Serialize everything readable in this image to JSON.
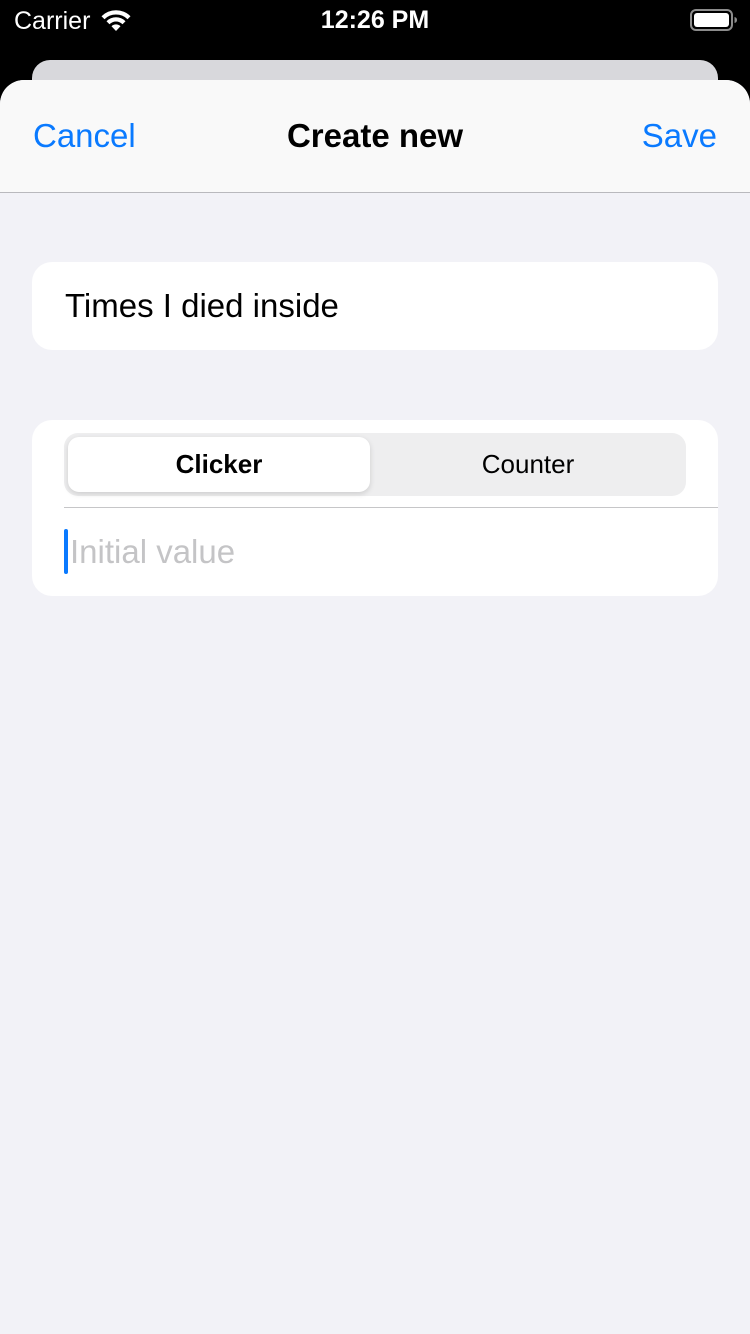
{
  "status_bar": {
    "carrier": "Carrier",
    "time": "12:26 PM",
    "wifi_icon": "wifi-icon",
    "battery_icon": "battery-icon",
    "battery_level": 1.0
  },
  "nav": {
    "cancel_label": "Cancel",
    "title": "Create new",
    "save_label": "Save"
  },
  "name_field": {
    "value": "Times I died inside"
  },
  "type_picker": {
    "options": [
      "Clicker",
      "Counter"
    ],
    "selected": "Clicker"
  },
  "initial_value_field": {
    "placeholder": "Initial value",
    "value": ""
  },
  "colors": {
    "accent": "#0a7aff",
    "background": "#f2f2f7",
    "card": "#ffffff"
  }
}
